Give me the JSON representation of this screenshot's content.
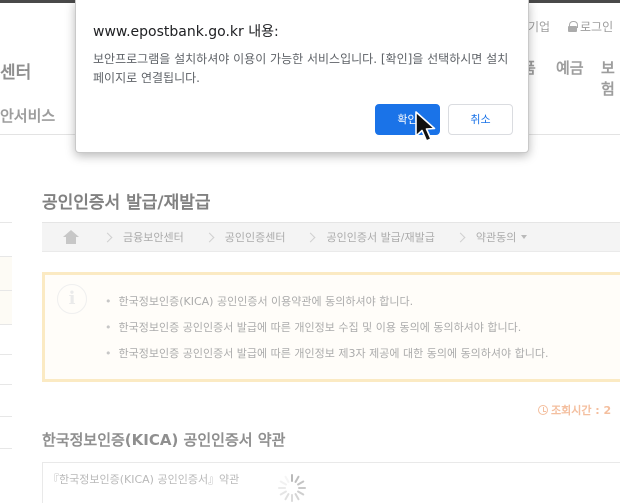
{
  "page": {
    "util_corporate": "기업",
    "util_login": "로그인",
    "logo_fragment": "센터",
    "gnb": [
      "품",
      "예금",
      "보험"
    ],
    "subnav_label": "안서비스",
    "title": "공인인증서 발급/재발급",
    "breadcrumb": [
      "금융보안센터",
      "공인인증센터",
      "공인인증서 발급/재발급",
      "약관동의"
    ],
    "notice_items": [
      "한국정보인증(KICA) 공인인증서 이용약관에 동의하셔야 합니다.",
      "한국정보인증 공인인증서 발급에 따른 개인정보 수집 및 이용 동의에 동의하셔야 합니다.",
      "한국정보인증 공인인증서 발급에 따른 개인정보 제3자 제공에 대한 동의에 동의하셔야 합니다."
    ],
    "timer_label": "조회시간 : 2",
    "terms_title": "한국정보인증(KICA) 공인인증서 약관",
    "terms_doc": "『한국정보인증(KICA) 공인인증서』약관"
  },
  "dialog": {
    "title": "www.epostbank.go.kr 내용:",
    "message": "보안프로그램을 설치하셔야 이용이 가능한 서비스입니다. [확인]을 선택하시면 설치페이지로 연결됩니다.",
    "ok_label": "확인",
    "cancel_label": "취소"
  },
  "colors": {
    "accent": "#1a73e8",
    "notice_border": "#fbe6b6",
    "timer": "#f2b18a"
  },
  "icons": [
    "lock-icon",
    "home-icon",
    "chevron-right-icon",
    "info-icon",
    "clock-icon",
    "loading-spinner-icon",
    "mouse-cursor-icon"
  ]
}
